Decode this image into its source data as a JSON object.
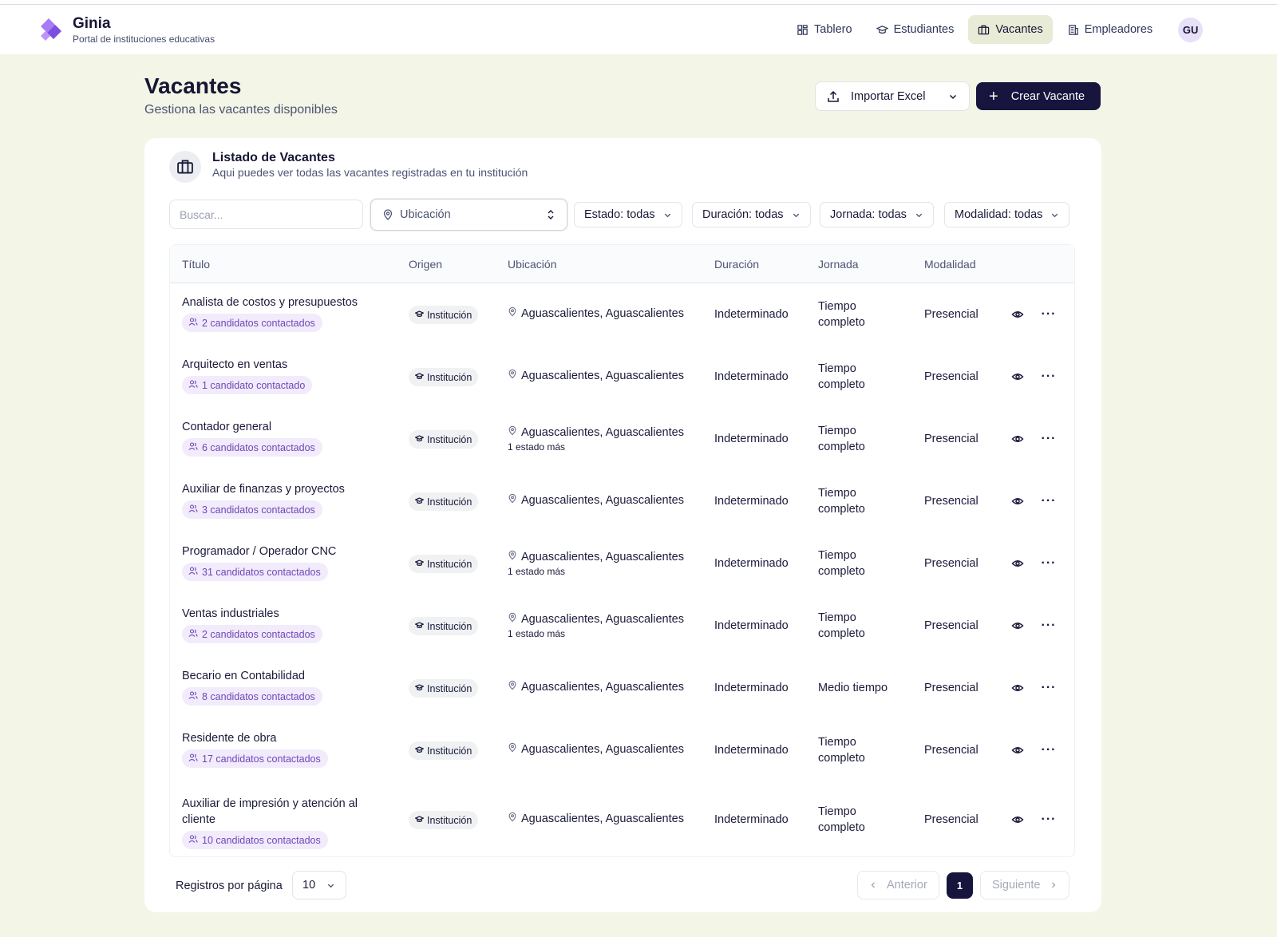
{
  "app": {
    "name": "Ginia",
    "subtitle": "Portal de instituciones educativas",
    "brand_color": "#9b6ef3"
  },
  "nav": {
    "items": [
      {
        "label": "Tablero",
        "icon": "dashboard-icon"
      },
      {
        "label": "Estudiantes",
        "icon": "graduation-cap-icon"
      },
      {
        "label": "Vacantes",
        "icon": "briefcase-icon",
        "active": true
      },
      {
        "label": "Empleadores",
        "icon": "building-icon"
      }
    ],
    "avatar": "GU"
  },
  "page": {
    "title": "Vacantes",
    "subtitle": "Gestiona las vacantes disponibles"
  },
  "actions": {
    "import_label": "Importar Excel",
    "create_label": "Crear Vacante",
    "create_plus": "+"
  },
  "card": {
    "title": "Listado de Vacantes",
    "subtitle": "Aqui puedes ver todas las vacantes registradas en tu institución"
  },
  "filters": {
    "search_placeholder": "Buscar...",
    "location_label": "Ubicación",
    "estado": "Estado: todas",
    "duracion": "Duración: todas",
    "jornada": "Jornada: todas",
    "modalidad": "Modalidad: todas"
  },
  "table": {
    "headers": {
      "titulo": "Título",
      "origen": "Origen",
      "ubicacion": "Ubicación",
      "duracion": "Duración",
      "jornada": "Jornada",
      "modalidad": "Modalidad"
    },
    "rows": [
      {
        "title": "Analista de costos y presupuestos",
        "candidates": "2 candidatos contactados",
        "origin": "Institución",
        "location": "Aguascalientes, Aguascalientes",
        "location_more": "",
        "duration": "Indeterminado",
        "schedule": "Tiempo completo",
        "modality": "Presencial"
      },
      {
        "title": "Arquitecto en ventas",
        "candidates": "1 candidato contactado",
        "origin": "Institución",
        "location": "Aguascalientes, Aguascalientes",
        "location_more": "",
        "duration": "Indeterminado",
        "schedule": "Tiempo completo",
        "modality": "Presencial"
      },
      {
        "title": "Contador general",
        "candidates": "6 candidatos contactados",
        "origin": "Institución",
        "location": "Aguascalientes, Aguascalientes",
        "location_more": "1 estado más",
        "duration": "Indeterminado",
        "schedule": "Tiempo completo",
        "modality": "Presencial"
      },
      {
        "title": "Auxiliar de finanzas y proyectos",
        "candidates": "3 candidatos contactados",
        "origin": "Institución",
        "location": "Aguascalientes, Aguascalientes",
        "location_more": "",
        "duration": "Indeterminado",
        "schedule": "Tiempo completo",
        "modality": "Presencial"
      },
      {
        "title": "Programador / Operador CNC",
        "candidates": "31 candidatos contactados",
        "origin": "Institución",
        "location": "Aguascalientes, Aguascalientes",
        "location_more": "1 estado más",
        "duration": "Indeterminado",
        "schedule": "Tiempo completo",
        "modality": "Presencial"
      },
      {
        "title": "Ventas industriales",
        "candidates": "2 candidatos contactados",
        "origin": "Institución",
        "location": "Aguascalientes, Aguascalientes",
        "location_more": "1 estado más",
        "duration": "Indeterminado",
        "schedule": "Tiempo completo",
        "modality": "Presencial"
      },
      {
        "title": "Becario en Contabilidad",
        "candidates": "8 candidatos contactados",
        "origin": "Institución",
        "location": "Aguascalientes, Aguascalientes",
        "location_more": "",
        "duration": "Indeterminado",
        "schedule": "Medio tiempo",
        "modality": "Presencial"
      },
      {
        "title": "Residente de obra",
        "candidates": "17 candidatos contactados",
        "origin": "Institución",
        "location": "Aguascalientes, Aguascalientes",
        "location_more": "",
        "duration": "Indeterminado",
        "schedule": "Tiempo completo",
        "modality": "Presencial"
      },
      {
        "title": "Auxiliar de impresión y atención al cliente",
        "candidates": "10 candidatos contactados",
        "origin": "Institución",
        "location": "Aguascalientes, Aguascalientes",
        "location_more": "",
        "duration": "Indeterminado",
        "schedule": "Tiempo completo",
        "modality": "Presencial"
      }
    ]
  },
  "pagination": {
    "per_page_label": "Registros por página",
    "per_page": "10",
    "prev": "Anterior",
    "current": "1",
    "next": "Siguiente"
  }
}
